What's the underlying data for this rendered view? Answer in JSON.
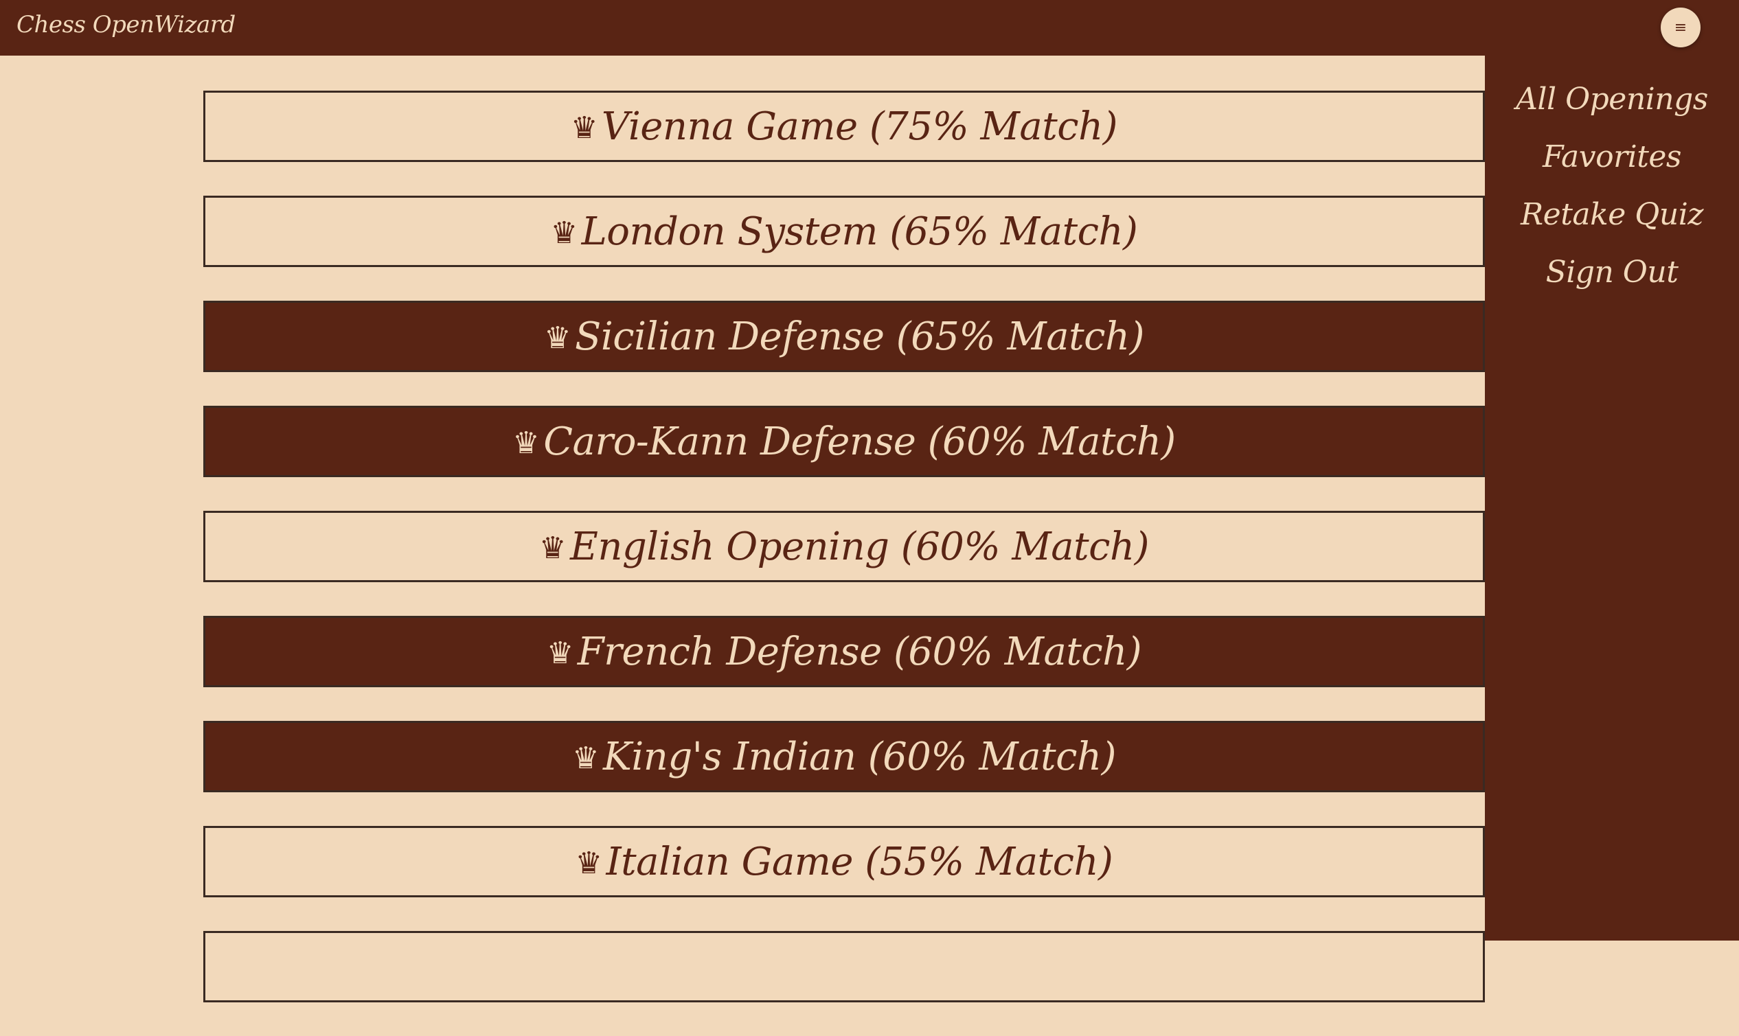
{
  "app": {
    "title": "Chess OpenWizard",
    "menu_icon": "≡"
  },
  "colors": {
    "primary": "#592414",
    "background": "#f2d9bb",
    "border": "#3a2a22"
  },
  "openings": [
    {
      "icon": "♛",
      "label": "Vienna Game (75% Match)",
      "style": "light"
    },
    {
      "icon": "♛",
      "label": "London System (65% Match)",
      "style": "light"
    },
    {
      "icon": "♛",
      "label": "Sicilian Defense (65% Match)",
      "style": "dark"
    },
    {
      "icon": "♛",
      "label": "Caro-Kann Defense (60% Match)",
      "style": "dark"
    },
    {
      "icon": "♛",
      "label": "English Opening (60% Match)",
      "style": "light"
    },
    {
      "icon": "♛",
      "label": "French Defense (60% Match)",
      "style": "dark"
    },
    {
      "icon": "♛",
      "label": "King's Indian (60% Match)",
      "style": "dark"
    },
    {
      "icon": "♛",
      "label": "Italian Game (55% Match)",
      "style": "light"
    },
    {
      "icon": "",
      "label": "",
      "style": "light"
    }
  ],
  "drawer": {
    "links": [
      "All Openings",
      "Favorites",
      "Retake Quiz",
      "Sign Out"
    ]
  }
}
